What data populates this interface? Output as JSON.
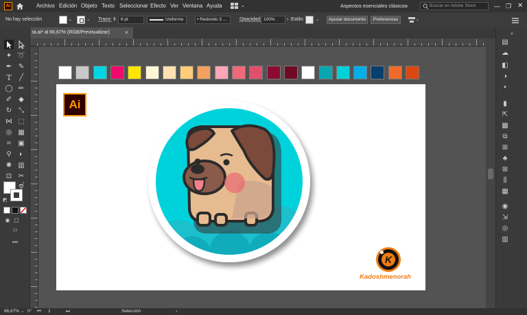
{
  "menu": {
    "logo": "Ai",
    "items": [
      "Archivo",
      "Edición",
      "Objeto",
      "Texto",
      "Seleccionar",
      "Efecto",
      "Ver",
      "Ventana",
      "Ayuda"
    ],
    "workspace": "Aspectos esenciales clásicos",
    "stock_search_placeholder": "Buscar en Adobe Stock"
  },
  "control_bar": {
    "selection_status": "No hay selección",
    "stroke_label": "Trazo:",
    "stroke_value": "6 pt",
    "profile_value": "Uniforme",
    "brush_value": "Redondo 3 ...",
    "opacity_label": "Opacidad:",
    "opacity_value": "100%",
    "style_label": "Estilo:",
    "adjust_button": "Ajustar documento",
    "prefs_button": "Preferencias"
  },
  "tab": {
    "title": "ta.ai* al 66,67% (RGB/Previsualizar)",
    "close": "×"
  },
  "statusbar": {
    "zoom": "66,67%",
    "rotation": "0°",
    "artboard_number": "1",
    "tool_status": "Selección"
  },
  "swatches": [
    "#ffffff",
    "#c8c8c8",
    "#00d6e3",
    "#ec0c6c",
    "#ffe600",
    "#fff6d6",
    "#ffe0b3",
    "#ffcd7a",
    "#f2a25c",
    "#ffa6b6",
    "#f0697a",
    "#e04f6b",
    "#8c0a33",
    "#6e0a24",
    "#ffffff",
    "#0aa6b0",
    "#00d0d8",
    "#00aee8",
    "#073f6e",
    "#f06b2a",
    "#d9480f"
  ],
  "artwork": {
    "ai_badge": "Ai",
    "k_logo": "K",
    "brand": "Kadoshmenorah"
  },
  "colors": {
    "ui_dark": "#323232",
    "ui_mid": "#3c3c3c",
    "canvas": "#535353",
    "circle": "#00d2dc",
    "clouds": "#16b8c8",
    "dog_fur": "#e3b58c",
    "dog_ear": "#7a4a3a",
    "brand_orange": "#f07d12"
  }
}
